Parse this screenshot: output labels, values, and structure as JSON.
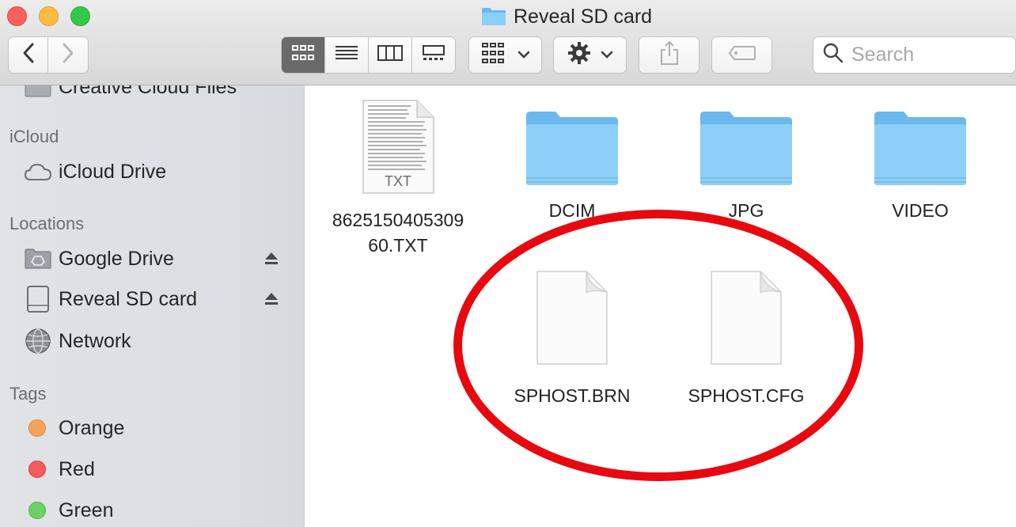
{
  "window": {
    "title": "Reveal SD card"
  },
  "toolbar": {
    "back_icon": "chevron-left-icon",
    "forward_icon": "chevron-right-icon",
    "view_modes": [
      "icon-view",
      "list-view",
      "column-view",
      "gallery-view"
    ],
    "active_view": "icon-view"
  },
  "search": {
    "placeholder": "Search"
  },
  "sidebar": {
    "partial_item": "Creative Cloud Files",
    "sections": {
      "icloud": "iCloud",
      "locations": "Locations",
      "tags": "Tags"
    },
    "icloud_items": [
      {
        "label": "iCloud Drive",
        "icon": "cloud-icon"
      }
    ],
    "location_items": [
      {
        "label": "Google Drive",
        "icon": "google-drive-icon",
        "eject": true
      },
      {
        "label": "Reveal SD card",
        "icon": "drive-icon",
        "eject": true
      },
      {
        "label": "Network",
        "icon": "globe-icon",
        "eject": false
      }
    ],
    "tag_items": [
      {
        "label": "Orange",
        "color": "#f5a25a"
      },
      {
        "label": "Red",
        "color": "#f25c5c"
      },
      {
        "label": "Green",
        "color": "#6dd163"
      }
    ]
  },
  "files": [
    {
      "name_line1": "8625150405309",
      "name_line2": "60.TXT",
      "type": "txt-document",
      "badge": "TXT"
    },
    {
      "name_line1": "DCIM",
      "type": "folder"
    },
    {
      "name_line1": "JPG",
      "type": "folder"
    },
    {
      "name_line1": "VIDEO",
      "type": "folder"
    },
    {
      "name_line1": "SPHOST.BRN",
      "type": "blank-document"
    },
    {
      "name_line1": "SPHOST.CFG",
      "type": "blank-document"
    }
  ],
  "annotation": {
    "shape": "red-oval",
    "color": "#e8080f"
  }
}
